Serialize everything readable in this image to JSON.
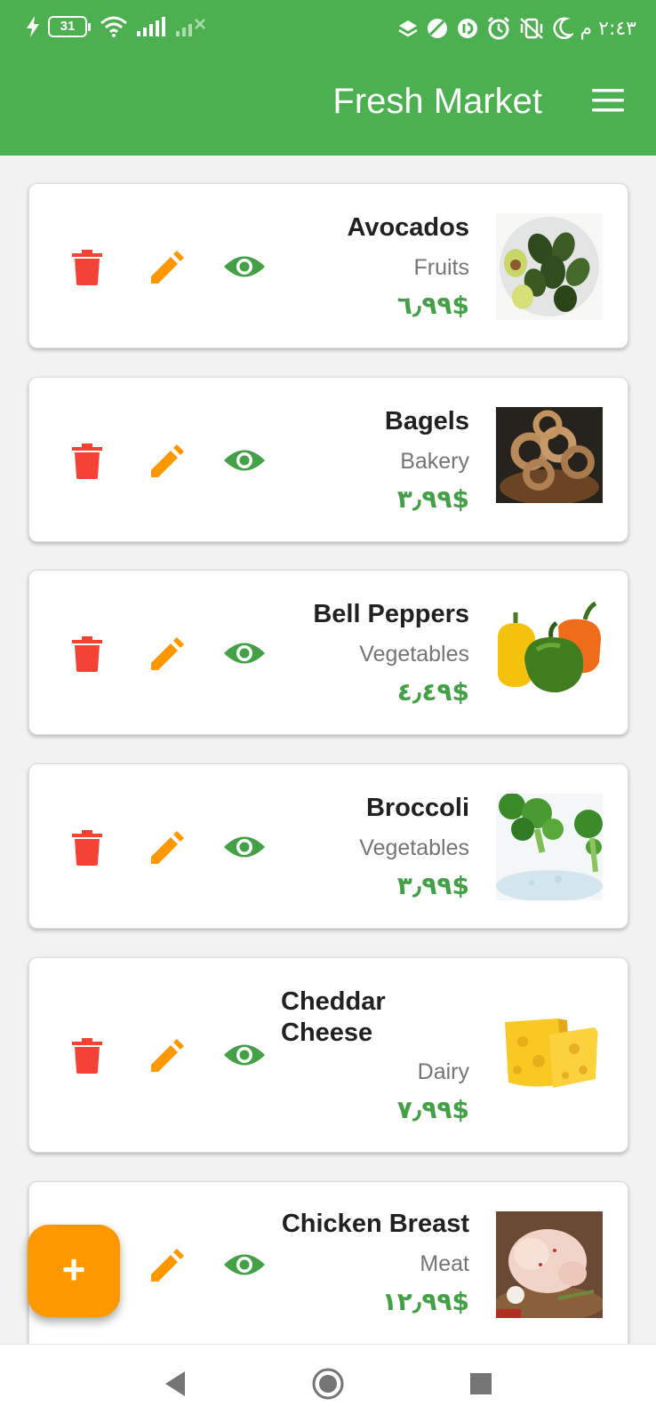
{
  "status_bar": {
    "battery": "31",
    "time": "٢:٤٣ م"
  },
  "app_bar": {
    "title": "Fresh Market"
  },
  "products": [
    {
      "name": "Avocados",
      "category": "Fruits",
      "price": "٦٫٩٩$",
      "image": "avocados-photo"
    },
    {
      "name": "Bagels",
      "category": "Bakery",
      "price": "٣٫٩٩$",
      "image": "bagels-photo"
    },
    {
      "name": "Bell Peppers",
      "category": "Vegetables",
      "price": "٤٫٤٩$",
      "image": "bell-peppers-photo"
    },
    {
      "name": "Broccoli",
      "category": "Vegetables",
      "price": "٣٫٩٩$",
      "image": "broccoli-photo"
    },
    {
      "name": "Cheddar Cheese",
      "category": "Dairy",
      "price": "٧٫٩٩$",
      "image": "cheddar-cheese-photo"
    },
    {
      "name": "Chicken Breast",
      "category": "Meat",
      "price": "١٢٫٩٩$",
      "image": "chicken-breast-photo"
    }
  ],
  "fab": {
    "label": "+"
  },
  "colors": {
    "app_bar": "#4caf50",
    "delete": "#f44336",
    "edit": "#ff9800",
    "view": "#43a047",
    "price": "#43a047",
    "fab": "#ff9800"
  },
  "icons": [
    "delete-icon",
    "edit-icon",
    "eye-icon",
    "menu-icon",
    "back-icon",
    "home-icon",
    "recents-icon"
  ]
}
